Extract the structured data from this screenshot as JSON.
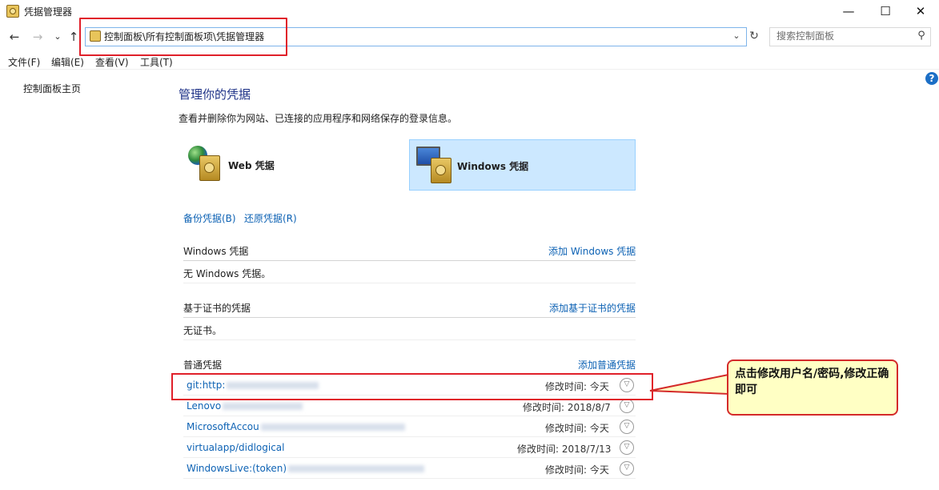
{
  "window": {
    "title": "凭据管理器",
    "minimize_glyph": "—",
    "maximize_glyph": "☐",
    "close_glyph": "✕"
  },
  "address_bar": {
    "path": "控制面板\\所有控制面板项\\凭据管理器",
    "search_placeholder": "搜索控制面板"
  },
  "nav_buttons": {
    "back": "←",
    "forward": "→",
    "recent": "⌄",
    "up": "↑"
  },
  "menu": {
    "items": [
      "文件(F)",
      "编辑(E)",
      "查看(V)",
      "工具(T)"
    ]
  },
  "sidebar": {
    "home_link": "控制面板主页"
  },
  "main": {
    "title": "管理你的凭据",
    "description": "查看并删除你为网站、已连接的应用程序和网络保存的登录信息。",
    "tiles": [
      {
        "label": "Web 凭据",
        "selected": false
      },
      {
        "label": "Windows 凭据",
        "selected": true
      }
    ],
    "backup_link": "备份凭据(B)",
    "restore_link": "还原凭据(R)",
    "sections": {
      "windows": {
        "title": "Windows 凭据",
        "add_link": "添加 Windows 凭据",
        "empty_text": "无 Windows 凭据。"
      },
      "certificate": {
        "title": "基于证书的凭据",
        "add_link": "添加基于证书的凭据",
        "empty_text": "无证书。"
      },
      "generic": {
        "title": "普通凭据",
        "add_link": "添加普通凭据",
        "modified_prefix": "修改时间:",
        "items": [
          {
            "name": "git:http:",
            "modified": "今天"
          },
          {
            "name": "Lenovo",
            "modified": "2018/8/7"
          },
          {
            "name": "MicrosoftAccou",
            "modified": "今天"
          },
          {
            "name": "virtualapp/didlogical",
            "modified": "2018/7/13"
          },
          {
            "name": "WindowsLive:(token)",
            "modified": "今天"
          }
        ]
      }
    }
  },
  "annotation": {
    "callout_text": "点击修改用户名/密码,修改正确即可",
    "highlight_color": "#e0202a",
    "callout_background": "#ffffc4"
  },
  "colors": {
    "link": "#0d62b4",
    "heading": "#1e3287",
    "selected_tile": "#cce8ff"
  }
}
